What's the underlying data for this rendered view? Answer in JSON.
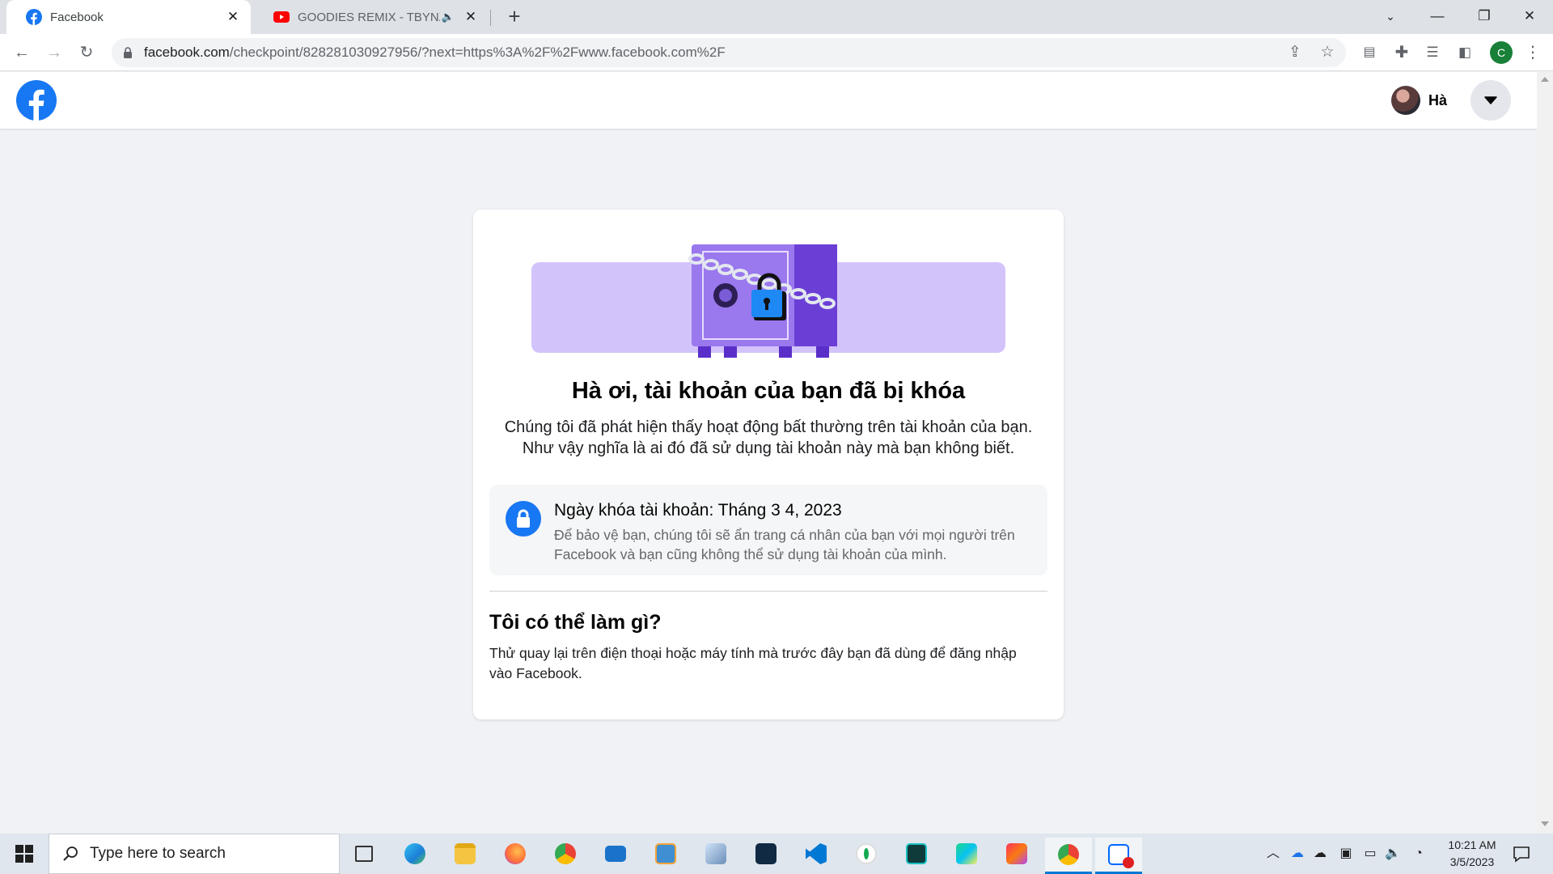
{
  "browser": {
    "tabs": [
      {
        "title": "Facebook",
        "active": true,
        "favicon": "facebook-icon"
      },
      {
        "title": "GOODIES REMIX - TBYNZ RE",
        "active": false,
        "favicon": "youtube-icon",
        "audio": true
      }
    ],
    "address": {
      "host": "facebook.com",
      "path": "/checkpoint/828281030927956/?next=https%3A%2F%2Fwww.facebook.com%2F"
    },
    "profile_initial": "C",
    "accent": "#1a73e8"
  },
  "fb": {
    "brand_color": "#1877f2",
    "user_name": "Hà"
  },
  "card": {
    "title": "Hà ơi, tài khoản của bạn đã bị khóa",
    "description": "Chúng tôi đã phát hiện thấy hoạt động bất thường trên tài khoản của bạn. Như vậy nghĩa là ai đó đã sử dụng tài khoản này mà bạn không biết.",
    "info_title": "Ngày khóa tài khoản: Tháng 3 4, 2023",
    "info_desc": "Để bảo vệ bạn, chúng tôi sẽ ẩn trang cá nhân của bạn với mọi người trên Facebook và bạn cũng không thể sử dụng tài khoản của mình.",
    "what_title": "Tôi có thể làm gì?",
    "what_desc": "Thử quay lại trên điện thoại hoặc máy tính mà trước đây bạn đã dùng để đăng nhập vào Facebook."
  },
  "taskbar": {
    "search_placeholder": "Type here to search",
    "time": "10:21 AM",
    "date": "3/5/2023",
    "apps": [
      "task-view",
      "edge",
      "file-explorer",
      "firefox",
      "chrome",
      "mail",
      "app-v",
      "app-box",
      "app-terminal",
      "vscode",
      "mongodb-compass",
      "app-jetbrains",
      "webstorm",
      "intellij",
      "chrome-active",
      "zalo"
    ]
  }
}
